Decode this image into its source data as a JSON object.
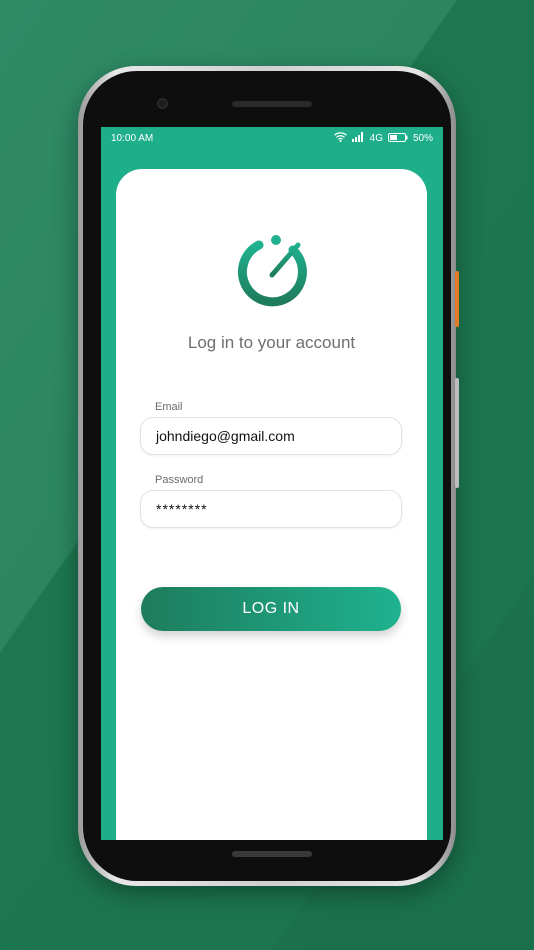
{
  "status_bar": {
    "time": "10:00 AM",
    "network": "4G",
    "battery": "50%",
    "battery_level": 0.5
  },
  "login": {
    "title": "Log in to your account",
    "email_label": "Email",
    "email_value": "johndiego@gmail.com",
    "password_label": "Password",
    "password_value": "********",
    "button_label": "LOG IN"
  },
  "icons": {
    "logo": "stopwatch-logo-icon",
    "wifi": "wifi-icon",
    "signal": "signal-icon",
    "battery": "battery-icon"
  },
  "colors": {
    "brand_green": "#1fae8a",
    "dark_green": "#1e7c5c",
    "background": "#1f7a55"
  }
}
